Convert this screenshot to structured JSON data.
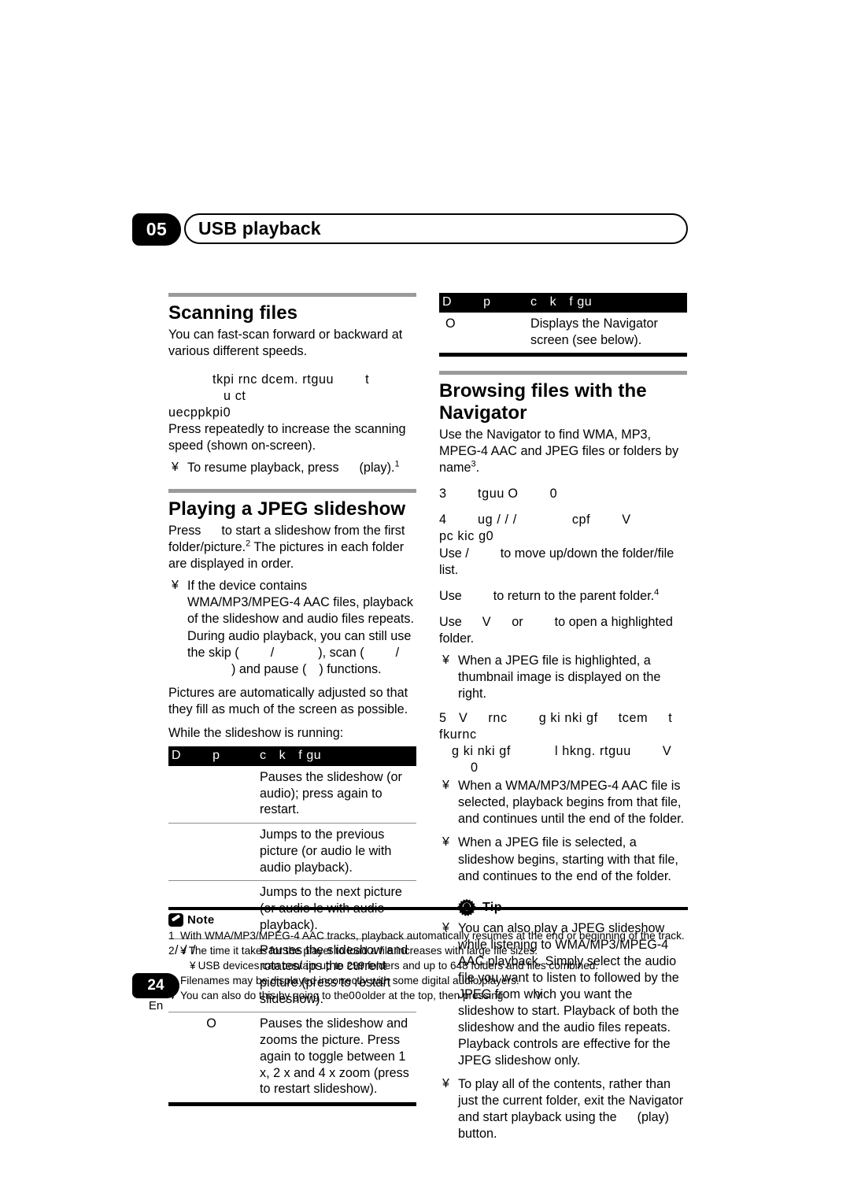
{
  "header": {
    "chapter_number": "05",
    "chapter_title": "USB playback"
  },
  "left_column": {
    "scanning": {
      "heading": "Scanning files",
      "intro": "You can fast-scan forward or backward at various different speeds.",
      "garbled_line_1": "tkpi rnc dcem. rtguu",
      "garbled_line_1b": "t",
      "garbled_line_1c": "u ct",
      "garbled_line_2": "uecppkpi0",
      "instruction": "Press repeatedly to increase the scanning speed (shown on-screen).",
      "bullet_1_pre": "To resume playback, press",
      "bullet_1_post": "(play).",
      "bullet_1_sup": "1"
    },
    "slideshow": {
      "heading": "Playing a JPEG slideshow",
      "intro_a": "Press",
      "intro_b": "to start a slideshow from the first folder/picture.",
      "intro_sup": "2",
      "intro_c": "The pictures in each folder are displayed in order.",
      "bullet_1_a": "If the device contains WMA/MP3/MPEG-4 AAC files, playback of the slideshow and audio files repeats. During audio playback, you can still use the skip (",
      "bullet_1_b": "/",
      "bullet_1_c": "), scan (",
      "bullet_1_d": "/",
      "bullet_1_e": ") and pause (",
      "bullet_1_f": ") functions.",
      "after_1": "Pictures are automatically adjusted so that they fill as much of the screen as possible.",
      "after_2": "While the slideshow is running:"
    },
    "table": {
      "header_col1_a": "D",
      "header_col1_b": "p",
      "header_col2_a": "c",
      "header_col2_b": "k",
      "header_col2_c": "f",
      "header_col2_d": "gu",
      "rows": [
        {
          "button": "",
          "description": "Pauses the slideshow (or audio); press again to restart."
        },
        {
          "button": "",
          "description": "Jumps to the previous picture (or audio  le with audio playback)."
        },
        {
          "button": "",
          "description": "Jumps to the next picture (or audio  le with audio playback)."
        },
        {
          "button": "/ / /",
          "description": "Pauses the slideshow and rotates/ ips the current picture (press    to restart slideshow)."
        },
        {
          "button": "O",
          "description": "Pauses the slideshow and zooms the picture. Press again to toggle between 1 x, 2 x and 4 x zoom (press    to restart slideshow)."
        }
      ]
    }
  },
  "right_column": {
    "table": {
      "header_col1_a": "D",
      "header_col1_b": "p",
      "header_col2_a": "c",
      "header_col2_b": "k",
      "header_col2_c": "f",
      "header_col2_d": "gu",
      "rows": [
        {
          "button": "O",
          "description": "Displays the Navigator screen (see below)."
        }
      ]
    },
    "browsing": {
      "heading_line1": "Browsing files with the",
      "heading_line2": "Navigator",
      "intro": "Use the Navigator to find WMA, MP3, MPEG-4 AAC and JPEG files or folders by name",
      "intro_sup": "3",
      "intro_end": ".",
      "step3_num": "3",
      "step3_a": "tguu",
      "step3_b": "O",
      "step3_c": "0",
      "step4_num": "4",
      "step4_a": "ug / / /",
      "step4_b": "cpf",
      "step4_c": "V",
      "step4_d": "pc kic g0",
      "use_1_a": "Use",
      "use_1_b": "/",
      "use_1_c": "to move up/down the folder/file list.",
      "use_2_a": "Use",
      "use_2_b": "to return to the parent folder.",
      "use_2_sup": "4",
      "use_3_a": "Use",
      "use_3_b": "V",
      "use_3_c": "or",
      "use_3_d": "to open a highlighted folder.",
      "bullet_1": "When a JPEG file is highlighted, a thumbnail image is displayed on the right.",
      "step5_num": "5",
      "step5_a": "V",
      "step5_b": "rnc",
      "step5_c": "g ki nki gf",
      "step5_d": "tcem",
      "step5_e": "t fkurnc",
      "step5_f": "g ki nki gf",
      "step5_g": "l hkng. rtguu",
      "step5_h": "V",
      "step5_i": "0",
      "bullet_2": "When a WMA/MP3/MPEG-4 AAC file is selected, playback begins from that file, and continues until the end of the folder.",
      "bullet_3": "When a JPEG file is selected, a slideshow begins, starting with that file, and continues to the end of the folder."
    },
    "tip": {
      "label": "Tip",
      "icon": "lightbulb-icon",
      "bullet_1": "You can also play a JPEG slideshow while listening to WMA/MP3/MPEG-4 AAC playback. Simply select the audio file you want to listen to followed by the JPEG from which you want the slideshow to start. Playback of both the slideshow and the audio files repeats. Playback controls are effective for the JPEG slideshow only.",
      "bullet_2_a": "To play all of the contents, rather than just the current folder, exit the Navigator and start playback using the",
      "bullet_2_b": "(play) button."
    }
  },
  "notes": {
    "label": "Note",
    "icon": "pencil-icon",
    "items": [
      {
        "num": "1",
        "text": "With WMA/MP3/MPEG-4 AAC tracks, playback automatically resumes at the end or beginning of the track."
      },
      {
        "num": "2",
        "text": "The time it takes for the player to load a file increases with large file sizes.",
        "sub": "USB devices can contain up to 299 folders and up to 648 folders and files combined.",
        "bulleted": true
      },
      {
        "num": "3",
        "text": "Filenames may be displayed incorrectly with some digital audio players."
      },
      {
        "num": "4",
        "text_a": "You can also do this by going to the",
        "text_b": "00",
        "text_c": "older at the top, then pressing",
        "text_d": "V",
        "text_e": "."
      }
    ]
  },
  "footer": {
    "page_number": "24",
    "language": "En"
  },
  "symbols": {
    "bullet": "¥"
  }
}
